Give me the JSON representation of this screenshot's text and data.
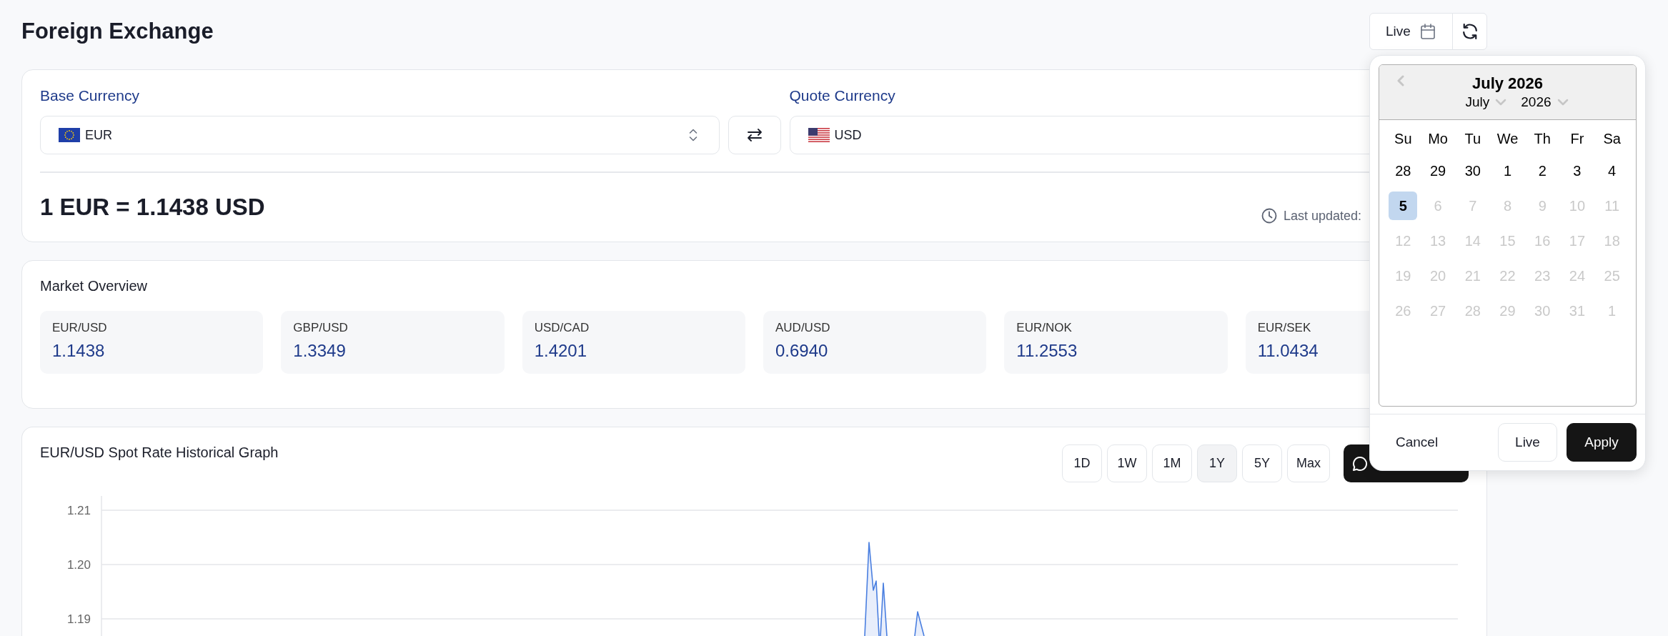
{
  "page": {
    "title": "Foreign Exchange"
  },
  "date_control": {
    "label": "Live"
  },
  "converter": {
    "base": {
      "label": "Base Currency",
      "value": "EUR"
    },
    "quote": {
      "label": "Quote Currency",
      "value": "USD"
    },
    "rate": "1 EUR = 1.1438 USD",
    "last_updated": "Last updated:"
  },
  "market_overview": {
    "title": "Market Overview",
    "pairs": [
      {
        "pair": "EUR/USD",
        "rate": "1.1438"
      },
      {
        "pair": "GBP/USD",
        "rate": "1.3349"
      },
      {
        "pair": "USD/CAD",
        "rate": "1.4201"
      },
      {
        "pair": "AUD/USD",
        "rate": "0.6940"
      },
      {
        "pair": "EUR/NOK",
        "rate": "11.2553"
      },
      {
        "pair": "EUR/SEK",
        "rate": "11.0434"
      }
    ]
  },
  "history_chart": {
    "title": "EUR/USD Spot Rate Historical Graph",
    "ranges": [
      {
        "label": "1D",
        "selected": false
      },
      {
        "label": "1W",
        "selected": false
      },
      {
        "label": "1M",
        "selected": false
      },
      {
        "label": "1Y",
        "selected": true
      },
      {
        "label": "5Y",
        "selected": false
      },
      {
        "label": "Max",
        "selected": false
      }
    ],
    "y_axis_labels": [
      "1.21",
      "1.20",
      "1.19"
    ]
  },
  "date_picker": {
    "heading": "July 2026",
    "month": "July",
    "year": "2026",
    "weekdays": [
      "Su",
      "Mo",
      "Tu",
      "We",
      "Th",
      "Fr",
      "Sa"
    ],
    "days": [
      {
        "label": "28",
        "selected": false,
        "disabled": false
      },
      {
        "label": "29",
        "selected": false,
        "disabled": false
      },
      {
        "label": "30",
        "selected": false,
        "disabled": false
      },
      {
        "label": "1",
        "selected": false,
        "disabled": false
      },
      {
        "label": "2",
        "selected": false,
        "disabled": false
      },
      {
        "label": "3",
        "selected": false,
        "disabled": false
      },
      {
        "label": "4",
        "selected": false,
        "disabled": false
      },
      {
        "label": "5",
        "selected": true,
        "disabled": false
      },
      {
        "label": "6",
        "selected": false,
        "disabled": true
      },
      {
        "label": "7",
        "selected": false,
        "disabled": true
      },
      {
        "label": "8",
        "selected": false,
        "disabled": true
      },
      {
        "label": "9",
        "selected": false,
        "disabled": true
      },
      {
        "label": "10",
        "selected": false,
        "disabled": true
      },
      {
        "label": "11",
        "selected": false,
        "disabled": true
      },
      {
        "label": "12",
        "selected": false,
        "disabled": true
      },
      {
        "label": "13",
        "selected": false,
        "disabled": true
      },
      {
        "label": "14",
        "selected": false,
        "disabled": true
      },
      {
        "label": "15",
        "selected": false,
        "disabled": true
      },
      {
        "label": "16",
        "selected": false,
        "disabled": true
      },
      {
        "label": "17",
        "selected": false,
        "disabled": true
      },
      {
        "label": "18",
        "selected": false,
        "disabled": true
      },
      {
        "label": "19",
        "selected": false,
        "disabled": true
      },
      {
        "label": "20",
        "selected": false,
        "disabled": true
      },
      {
        "label": "21",
        "selected": false,
        "disabled": true
      },
      {
        "label": "22",
        "selected": false,
        "disabled": true
      },
      {
        "label": "23",
        "selected": false,
        "disabled": true
      },
      {
        "label": "24",
        "selected": false,
        "disabled": true
      },
      {
        "label": "25",
        "selected": false,
        "disabled": true
      },
      {
        "label": "26",
        "selected": false,
        "disabled": true
      },
      {
        "label": "27",
        "selected": false,
        "disabled": true
      },
      {
        "label": "28",
        "selected": false,
        "disabled": true
      },
      {
        "label": "29",
        "selected": false,
        "disabled": true
      },
      {
        "label": "30",
        "selected": false,
        "disabled": true
      },
      {
        "label": "31",
        "selected": false,
        "disabled": true
      },
      {
        "label": "1",
        "selected": false,
        "disabled": true
      }
    ],
    "buttons": [
      {
        "label": "Cancel",
        "kind": "text"
      },
      {
        "label": "Live",
        "kind": "outline"
      },
      {
        "label": "Apply",
        "kind": "primary"
      }
    ]
  }
}
